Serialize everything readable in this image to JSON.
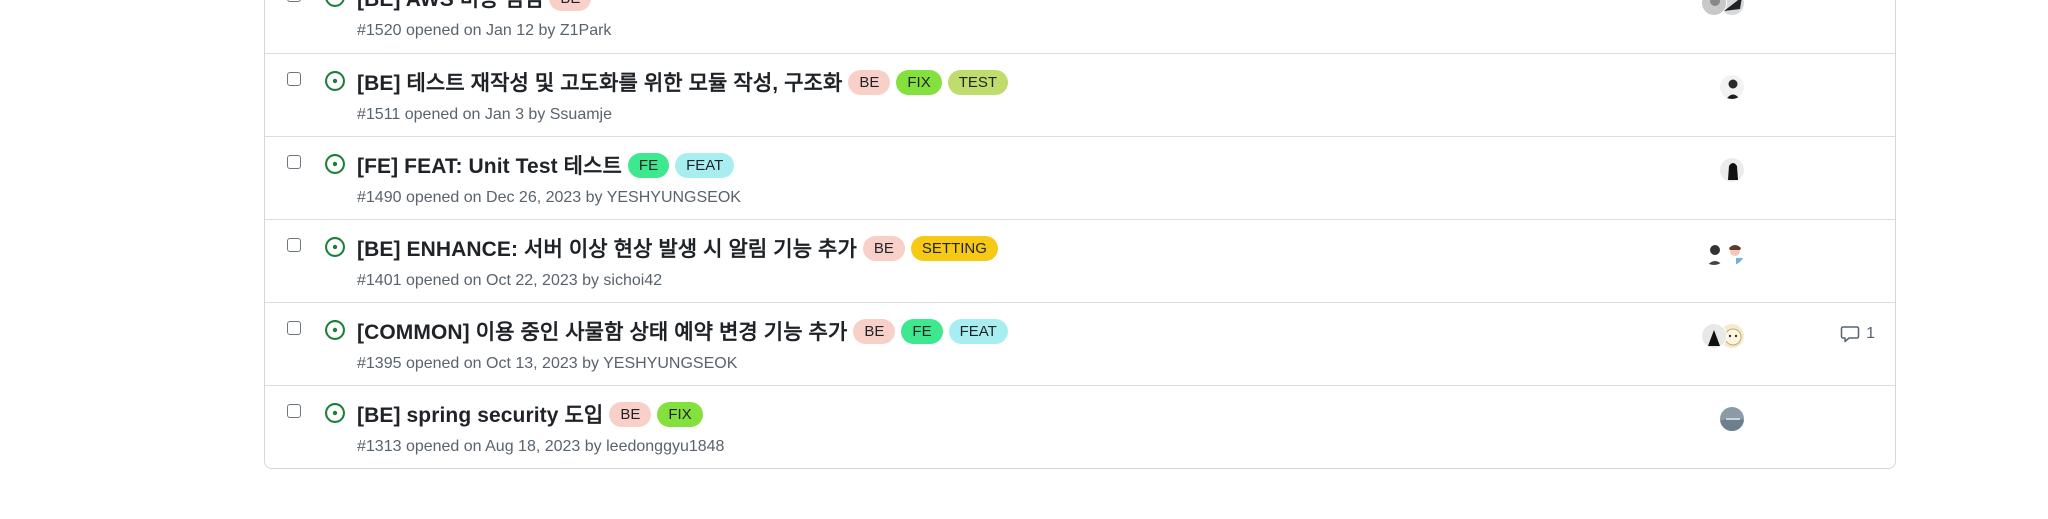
{
  "issues": [
    {
      "title": "[BE] AWS 비용 점검",
      "meta": "#1520 opened on Jan 12 by Z1Park",
      "labels": [
        {
          "text": "BE",
          "color": "#f8d0c8"
        }
      ],
      "comments": null
    },
    {
      "title": "[BE] 테스트 재작성 및 고도화를 위한 모듈 작성, 구조화",
      "meta": "#1511 opened on Jan 3 by Ssuamje",
      "labels": [
        {
          "text": "BE",
          "color": "#f8d0c8"
        },
        {
          "text": "FIX",
          "color": "#84e03c"
        },
        {
          "text": "TEST",
          "color": "#bfdc6c"
        }
      ],
      "comments": null
    },
    {
      "title": "[FE] FEAT: Unit Test 테스트",
      "meta": "#1490 opened on Dec 26, 2023 by YESHYUNGSEOK",
      "labels": [
        {
          "text": "FE",
          "color": "#3ee88f"
        },
        {
          "text": "FEAT",
          "color": "#a8eef0"
        }
      ],
      "comments": null
    },
    {
      "title": "[BE] ENHANCE: 서버 이상 현상 발생 시 알림 기능 추가",
      "meta": "#1401 opened on Oct 22, 2023 by sichoi42",
      "labels": [
        {
          "text": "BE",
          "color": "#f8d0c8"
        },
        {
          "text": "SETTING",
          "color": "#f7c915"
        }
      ],
      "comments": null
    },
    {
      "title": "[COMMON] 이용 중인 사물함 상태 예약 변경 기능 추가",
      "meta": "#1395 opened on Oct 13, 2023 by YESHYUNGSEOK",
      "labels": [
        {
          "text": "BE",
          "color": "#f8d0c8"
        },
        {
          "text": "FE",
          "color": "#3ee88f"
        },
        {
          "text": "FEAT",
          "color": "#a8eef0"
        }
      ],
      "comments": "1"
    },
    {
      "title": "[BE] spring security 도입",
      "meta": "#1313 opened on Aug 18, 2023 by leedonggyu1848",
      "labels": [
        {
          "text": "BE",
          "color": "#f8d0c8"
        },
        {
          "text": "FIX",
          "color": "#84e03c"
        }
      ],
      "comments": null
    }
  ],
  "colors": {
    "open_icon": "#1a7f37",
    "border": "#d0d7de",
    "meta_text": "#59636e"
  },
  "icons": {
    "state": "issue-opened-icon",
    "comment": "comment-icon"
  }
}
